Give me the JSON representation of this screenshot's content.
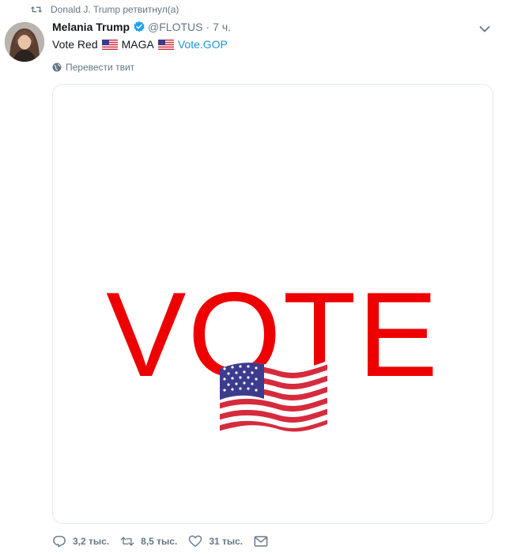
{
  "retweet": {
    "icon": "retweet-icon",
    "text": "Donald J. Trump ретвитнул(а)"
  },
  "tweet": {
    "author_name": "Melania Trump",
    "verified_icon": "verified-badge-icon",
    "handle": "@FLOTUS",
    "separator": "·",
    "time": "7 ч.",
    "text_parts": {
      "part1": "Vote Red",
      "part2": "MAGA",
      "link": "Vote.GOP"
    },
    "translate_label": "Перевести твит",
    "media": {
      "word": "VOTE",
      "emoji": "us-flag-icon"
    }
  },
  "actions": {
    "reply_count": "3,2 тыс.",
    "retweet_count": "8,5 тыс.",
    "like_count": "31 тыс."
  },
  "colors": {
    "accent_link": "#1b95e0",
    "vote_red": "#ee0000",
    "muted_text": "#657786"
  }
}
